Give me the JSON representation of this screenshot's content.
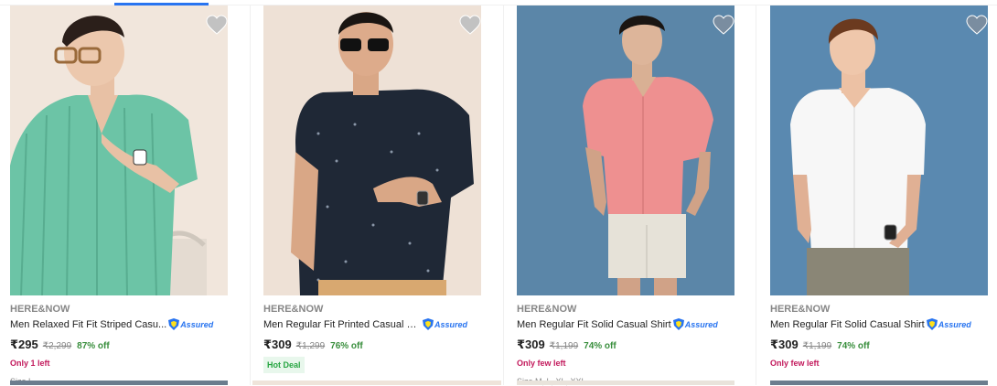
{
  "products": [
    {
      "brand": "HERE&NOW",
      "title": "Men Relaxed Fit Fit Striped Casu...",
      "price": "₹295",
      "mrp": "₹2,299",
      "discount": "87% off",
      "stock": "Only 1 left",
      "size": "Size L",
      "badge": "",
      "assured_label": "Assured",
      "shirt_color": "#6cc4a6",
      "bg_color": "#f1e6dc"
    },
    {
      "brand": "HERE&NOW",
      "title": "Men Regular Fit Printed Casual S...",
      "price": "₹309",
      "mrp": "₹1,299",
      "discount": "76% off",
      "stock": "",
      "size": "",
      "badge": "Hot Deal",
      "assured_label": "Assured",
      "shirt_color": "#1f2836",
      "bg_color": "#eee1d6"
    },
    {
      "brand": "HERE&NOW",
      "title": "Men Regular Fit Solid Casual Shirt",
      "price": "₹309",
      "mrp": "₹1,199",
      "discount": "74% off",
      "stock": "Only few left",
      "size": "Size M, L, XL, XXL",
      "badge": "",
      "assured_label": "Assured",
      "shirt_color": "#ee9090",
      "bg_color": "#5b86a8"
    },
    {
      "brand": "HERE&NOW",
      "title": "Men Regular Fit Solid Casual Shirt",
      "price": "₹309",
      "mrp": "₹1,199",
      "discount": "74% off",
      "stock": "Only few left",
      "size": "",
      "badge": "",
      "assured_label": "Assured",
      "shirt_color": "#f7f7f7",
      "bg_color": "#5a89b0"
    }
  ],
  "colors": {
    "accent": "#2874f0",
    "discount": "#388e3c",
    "stock": "#c2185b",
    "deal_bg": "#e8f7ec",
    "deal_text": "#26a541"
  },
  "icons": {
    "wishlist": "heart-icon",
    "assured": "assured-shield-icon"
  }
}
